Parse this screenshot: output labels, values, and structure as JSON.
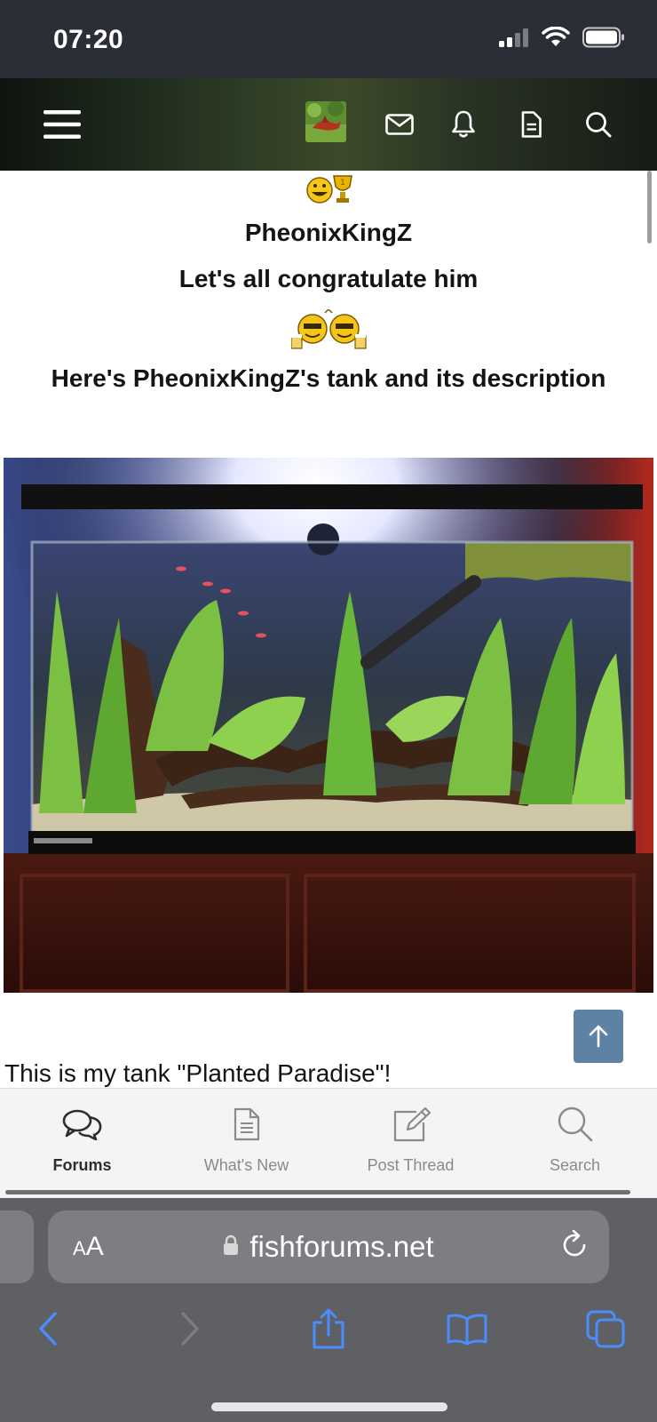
{
  "status_bar": {
    "time": "07:20"
  },
  "header": {
    "menu_icon": "hamburger-menu-icon",
    "icons": [
      "avatar",
      "envelope-icon",
      "bell-icon",
      "document-icon",
      "search-icon"
    ]
  },
  "post": {
    "member_name": "PheonixKingZ",
    "congrats_line": "Let's all congratulate him",
    "description_heading": "Here's PheonixKingZ's tank and its description",
    "body_text": "This is my tank \"Planted Paradise\"!"
  },
  "tab_bar": {
    "tabs": [
      {
        "label": "Forums",
        "icon": "speech-bubbles-icon",
        "active": true
      },
      {
        "label": "What's New",
        "icon": "document-icon",
        "active": false
      },
      {
        "label": "Post Thread",
        "icon": "compose-icon",
        "active": false
      },
      {
        "label": "Search",
        "icon": "search-icon",
        "active": false
      }
    ]
  },
  "safari": {
    "text_size_label_small": "A",
    "text_size_label_large": "A",
    "url": "fishforums.net"
  },
  "colors": {
    "status_bar_bg": "#2b2e36",
    "scroll_top_button": "#5d82a3",
    "tab_bar_bg": "#f4f4f4",
    "safari_bg": "#5f6063",
    "safari_icon_blue": "#4a8dff"
  }
}
